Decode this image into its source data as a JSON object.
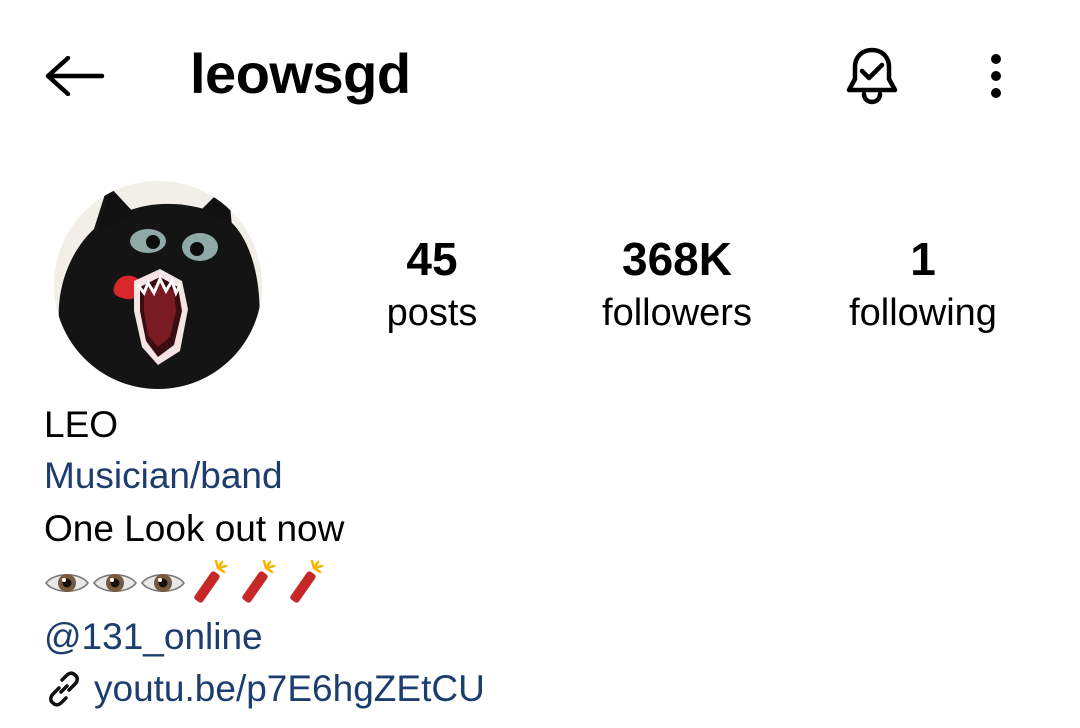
{
  "header": {
    "username": "leowsgd",
    "icons": {
      "back": "arrow-left-icon",
      "notifications": "bell-check-icon",
      "more": "more-vertical-icon"
    }
  },
  "profile": {
    "avatar": "black-creature-screaming-avatar",
    "stats": [
      {
        "value": "45",
        "label": "posts"
      },
      {
        "value": "368K",
        "label": "followers"
      },
      {
        "value": "1",
        "label": "following"
      }
    ]
  },
  "bio": {
    "display_name": "LEO",
    "category": "Musician/band",
    "text": "One Look out now",
    "emoji": [
      "eye",
      "eye",
      "eye",
      "firecracker",
      "firecracker",
      "firecracker"
    ],
    "mention": "@131_online",
    "link": "youtu.be/p7E6hgZEtCU"
  },
  "colors": {
    "text": "#000000",
    "link": "#1c3d6e",
    "background": "#ffffff"
  }
}
